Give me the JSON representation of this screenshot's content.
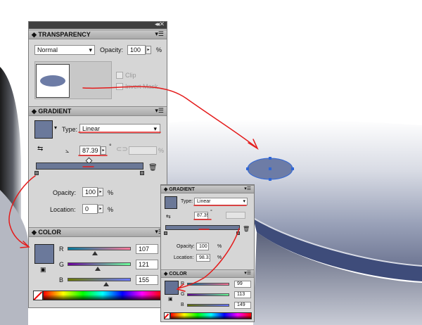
{
  "transparency": {
    "title": "TRANSPARENCY",
    "blend_mode": "Normal",
    "opacity_label": "Opacity:",
    "opacity_value": "100",
    "unit": "%",
    "clip_label": "Clip",
    "invert_mask_label": "Invert Mask"
  },
  "gradient_main": {
    "title": "GRADIENT",
    "type_label": "Type:",
    "type_value": "Linear",
    "angle_value": "87.39",
    "degree": "°",
    "aspect_unit": "%",
    "opacity_label": "Opacity:",
    "opacity_value": "100",
    "location_label": "Location:",
    "location_value": "0",
    "unit": "%"
  },
  "color_main": {
    "title": "COLOR",
    "r_label": "R",
    "g_label": "G",
    "b_label": "B",
    "r_value": "107",
    "g_value": "121",
    "b_value": "155",
    "r_fraction": 0.42,
    "g_fraction": 0.47,
    "b_fraction": 0.61,
    "swatch_color": "#6b799b"
  },
  "gradient_small": {
    "title": "GRADIENT",
    "type_label": "Type:",
    "type_value": "Linear",
    "angle_value": "87.39",
    "degree": "°",
    "opacity_label": "Opacity:",
    "opacity_value": "100",
    "location_label": "Location:",
    "location_value": "98.31",
    "unit": "%"
  },
  "color_small": {
    "title": "COLOR",
    "r_label": "R",
    "g_label": "G",
    "b_label": "B",
    "r_value": "99",
    "g_value": "113",
    "b_value": "149",
    "r_fraction": 0.39,
    "g_fraction": 0.44,
    "b_fraction": 0.58,
    "swatch_color": "#637195"
  },
  "colors": {
    "annotation": "#e41c1c",
    "selection": "#2f66d6",
    "ellipse_fill": "#6d7ca6",
    "swatch_main": "#6b799b"
  }
}
